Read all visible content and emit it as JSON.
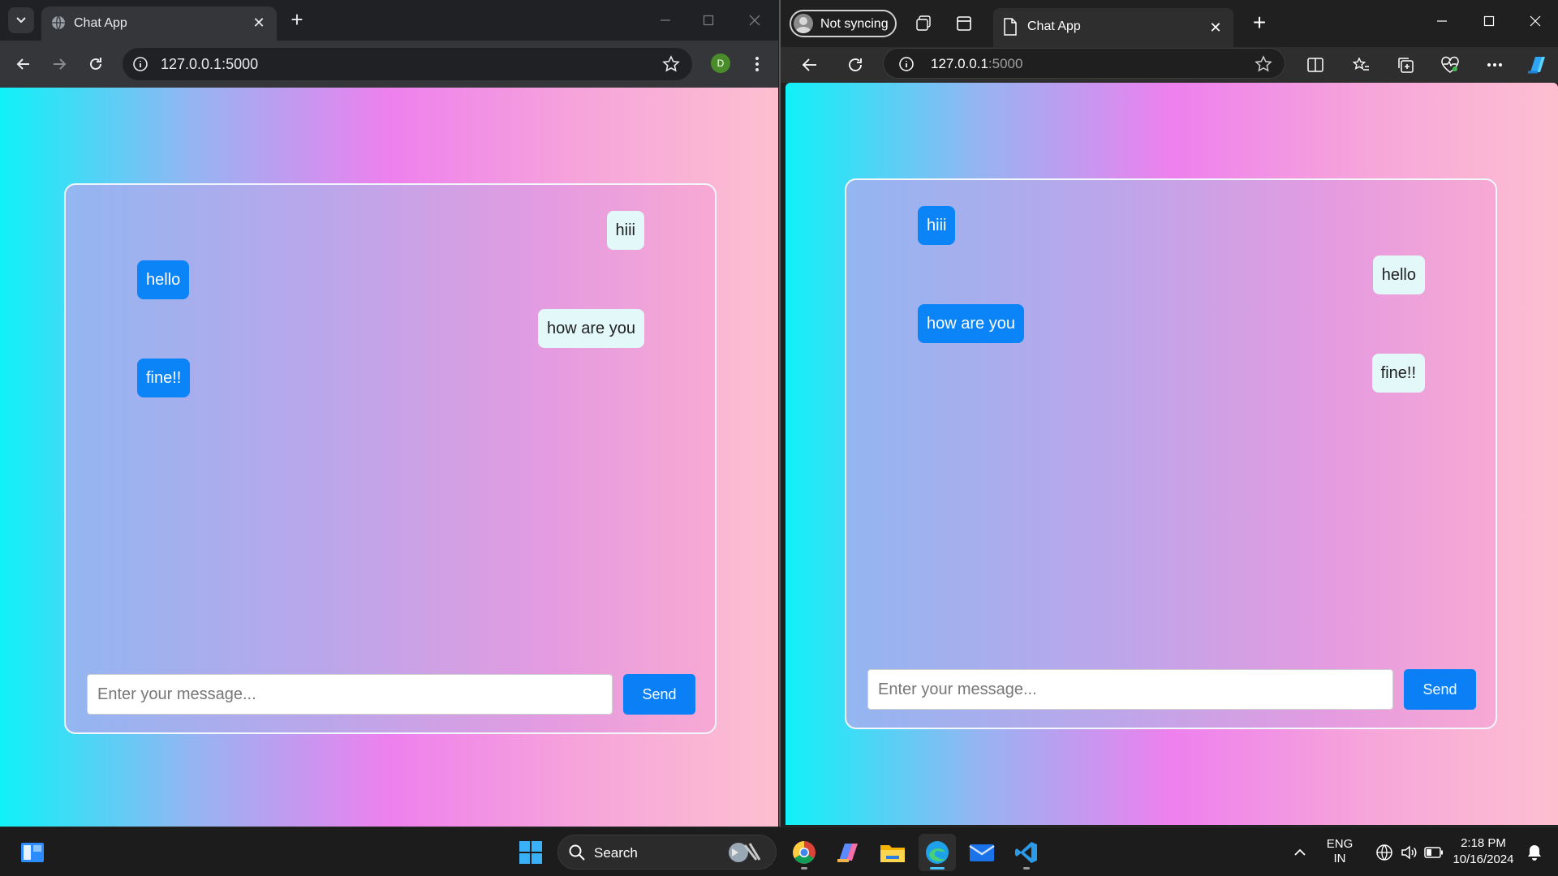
{
  "left_browser": {
    "tab_title": "Chat App",
    "url": "127.0.0.1:5000",
    "profile_initial": "D",
    "page": {
      "messages": [
        {
          "text": "hiii",
          "side": "right"
        },
        {
          "text": "hello",
          "side": "left"
        },
        {
          "text": "how are you",
          "side": "right"
        },
        {
          "text": "fine!!",
          "side": "left"
        }
      ],
      "input_placeholder": "Enter your message...",
      "input_value": "",
      "send_label": "Send"
    }
  },
  "right_browser": {
    "profile_label": "Not syncing",
    "tab_title": "Chat App",
    "url_host": "127.0.0.1",
    "url_port": ":5000",
    "page": {
      "messages": [
        {
          "text": "hiii",
          "side": "left"
        },
        {
          "text": "hello",
          "side": "right"
        },
        {
          "text": "how are you",
          "side": "left"
        },
        {
          "text": "fine!!",
          "side": "right"
        }
      ],
      "input_placeholder": "Enter your message...",
      "input_value": "",
      "send_label": "Send"
    }
  },
  "taskbar": {
    "search_label": "Search",
    "language_line1": "ENG",
    "language_line2": "IN",
    "time": "2:18 PM",
    "date": "10/16/2024"
  },
  "colors": {
    "sent_bubble": "#0a84f6",
    "received_bubble": "#e3f8f9",
    "send_button": "#0a7ff6",
    "gradient_start": "#10f1f8",
    "gradient_mid": "#ee80ee",
    "gradient_end": "#fdbfd0"
  }
}
